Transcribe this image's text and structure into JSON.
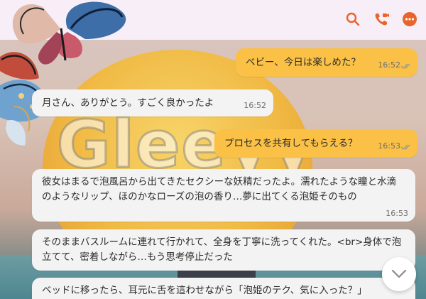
{
  "header": {
    "icons": [
      "search-icon",
      "video-call-icon",
      "more-icon"
    ],
    "accent_color": "#e8642c"
  },
  "background": {
    "logo_text": "Gleeyy"
  },
  "messages": [
    {
      "direction": "out",
      "text": "ベビー、今日は楽しめた？",
      "time": "16:52",
      "read": true
    },
    {
      "direction": "in",
      "text": "月さん、ありがとう。すごく良かったよ",
      "time": "16:52"
    },
    {
      "direction": "out",
      "text": "プロセスを共有してもらえる？",
      "time": "16:53",
      "read": true
    },
    {
      "direction": "in",
      "text": "彼女はまるで泡風呂から出てきたセクシーな妖精だったよ。濡れたような瞳と水滴のようなリップ、ほのかなローズの泡の香り…夢に出てくる泡姫そのもの",
      "time": "16:53"
    },
    {
      "direction": "in",
      "text": "そのままバスルームに連れて行かれて、全身を丁寧に洗ってくれた。<br>身体で泡立てて、密着しながら…もう思考停止だった",
      "time": ""
    },
    {
      "direction": "in",
      "text": "ベッドに移ったら、耳元に舌を這わせながら「泡姫のテク、気に入った？」",
      "time": ""
    }
  ],
  "colors": {
    "outgoing_bubble": "#fbc046",
    "incoming_bubble": "#f3f3f3",
    "header_bg": "#f7eef7",
    "read_ticks": "#9a9a9a"
  }
}
